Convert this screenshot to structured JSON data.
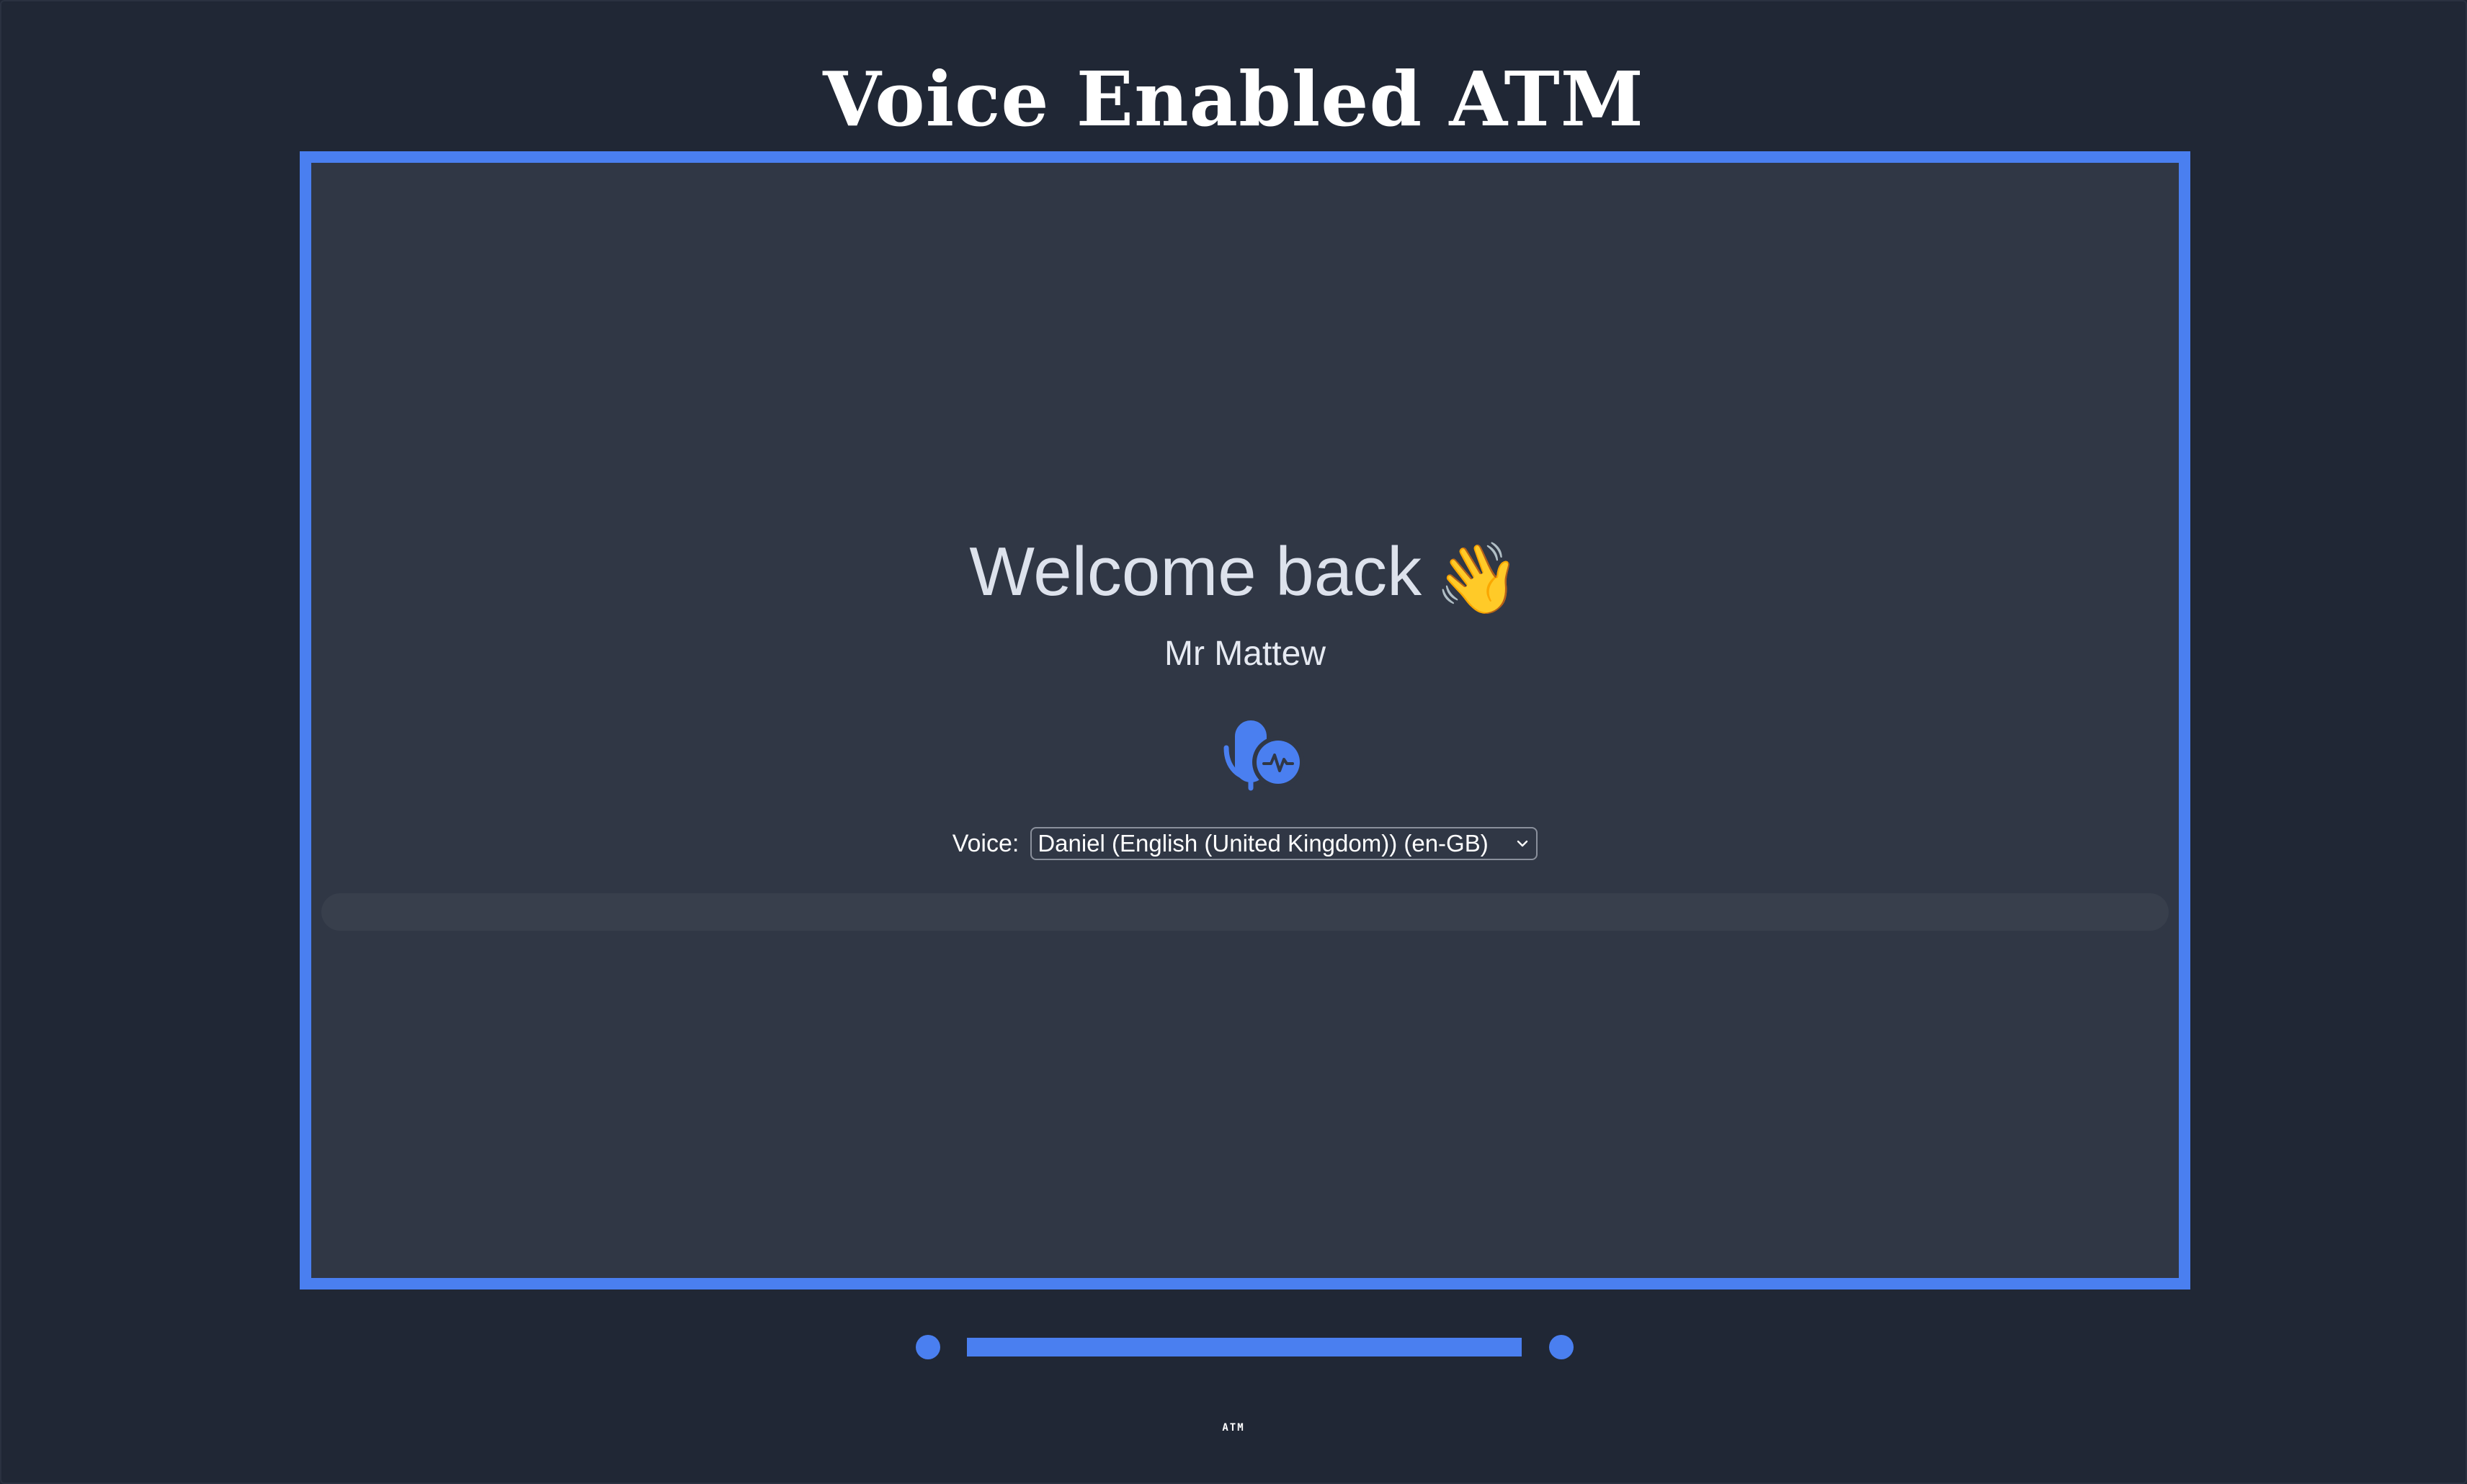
{
  "page": {
    "title": "Voice Enabled ATM",
    "caption": "ATM"
  },
  "screen": {
    "welcome": "Welcome back",
    "wave_emoji": "👋",
    "user_name": "Mr Mattew",
    "voice": {
      "label": "Voice:",
      "selected": "Daniel (English (United Kingdom)) (en-GB)"
    },
    "transcript": ""
  },
  "icons": {
    "mic": "microphone-activity-icon",
    "select_arrow": "chevron-down-icon"
  },
  "colors": {
    "background": "#202735",
    "screen": "#303745",
    "accent": "#4a7ff0",
    "text": "#dde2ec"
  }
}
